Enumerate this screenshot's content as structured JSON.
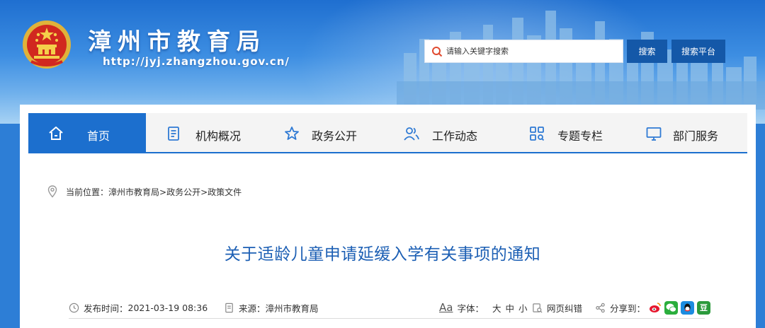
{
  "header": {
    "site_title": "漳州市教育局",
    "site_url": "http://jyj.zhangzhou.gov.cn/",
    "search_placeholder": "请输入关键字搜索",
    "search_button": "搜索",
    "search_platform_button": "搜索平台"
  },
  "nav": {
    "items": [
      {
        "label": "首页",
        "icon": "home-icon",
        "active": true
      },
      {
        "label": "机构概况",
        "icon": "document-list-icon"
      },
      {
        "label": "政务公开",
        "icon": "star-icon"
      },
      {
        "label": "工作动态",
        "icon": "users-icon"
      },
      {
        "label": "专题专栏",
        "icon": "grid-search-icon"
      },
      {
        "label": "部门服务",
        "icon": "monitor-icon"
      }
    ]
  },
  "breadcrumb": {
    "prefix": "当前位置：",
    "path": "漳州市教育局>政务公开>政策文件"
  },
  "article": {
    "title": "关于适龄儿童申请延缓入学有关事项的通知",
    "publish_label": "发布时间：",
    "publish_time": "2021-03-19 08:36",
    "source_label": "来源：",
    "source": "漳州市教育局",
    "font_label": "字体：",
    "font_large": "大",
    "font_medium": "中",
    "font_small": "小",
    "error_report": "网页纠错",
    "share_label": "分享到：",
    "share_targets": [
      "weibo-icon",
      "wechat-icon",
      "qq-icon",
      "douban-icon"
    ]
  },
  "colors": {
    "primary": "#1c6fce",
    "title_blue": "#1c5fb4",
    "button_dark": "#1458a8"
  }
}
